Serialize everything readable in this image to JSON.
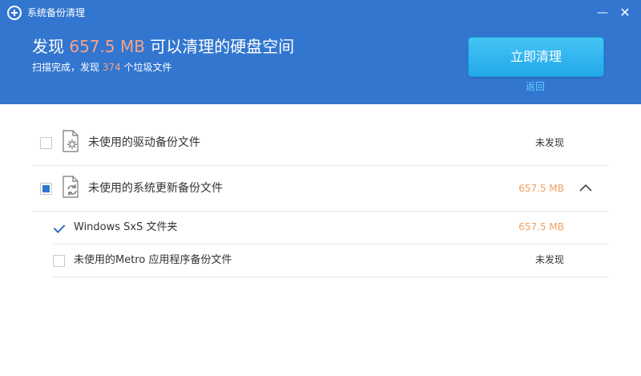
{
  "window": {
    "title": "系统备份清理",
    "minimize_label": "—",
    "close_label": "✕"
  },
  "summary": {
    "title_prefix": "发现 ",
    "size": "657.5 MB",
    "title_suffix": " 可以清理的硬盘空间",
    "sub_prefix": "扫描完成，发现 ",
    "count": "374",
    "sub_suffix": " 个垃圾文件"
  },
  "actions": {
    "clean_label": "立即清理",
    "back_label": "返回"
  },
  "colors": {
    "header_bg": "#3276d0",
    "highlight": "#f5a38a",
    "accent": "#2f78d0",
    "size_orange": "#f0a060"
  },
  "items": [
    {
      "label": "未使用的驱动备份文件",
      "status": "未发现",
      "check_state": "unchecked",
      "icon": "gear-file-icon"
    },
    {
      "label": "未使用的系统更新备份文件",
      "status": "657.5 MB",
      "check_state": "partial",
      "icon": "refresh-file-icon",
      "expanded": true,
      "children": [
        {
          "label": "Windows SxS 文件夹",
          "status": "657.5 MB",
          "check_state": "checked"
        },
        {
          "label": "未使用的Metro 应用程序备份文件",
          "status": "未发现",
          "check_state": "unchecked"
        }
      ]
    }
  ]
}
